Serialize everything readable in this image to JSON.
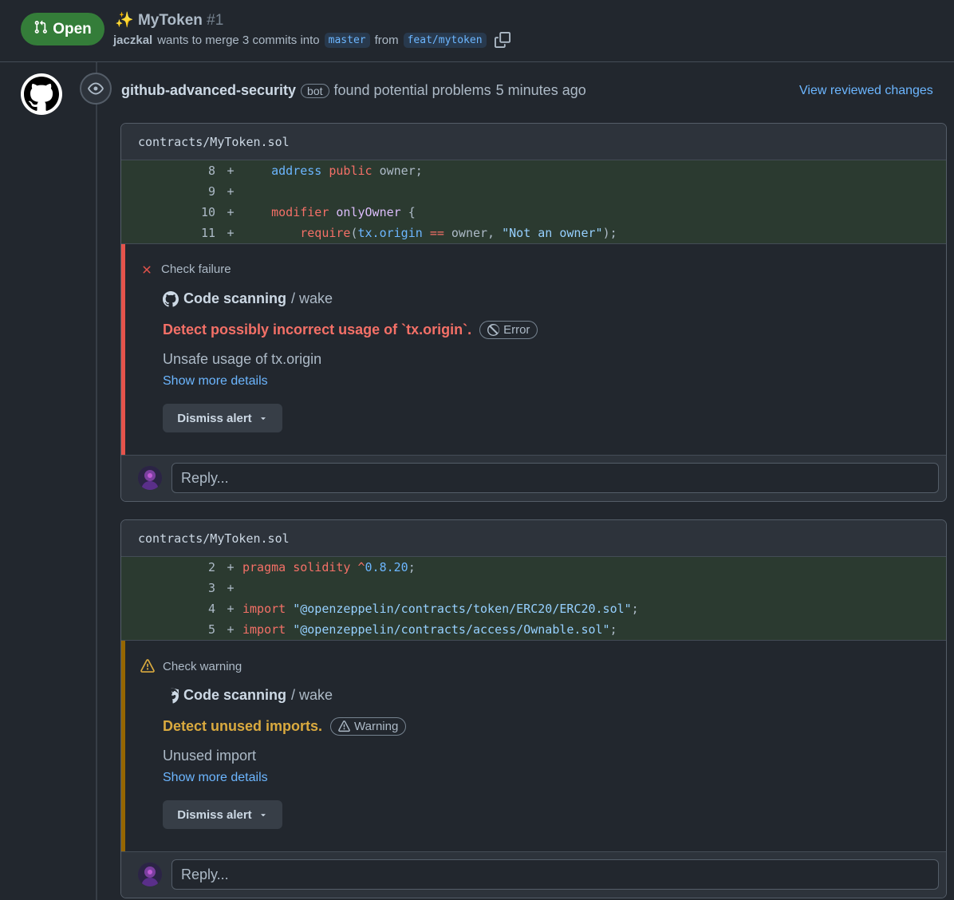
{
  "pr": {
    "status": "Open",
    "sparkle": "✨",
    "title": "MyToken",
    "number": "#1",
    "author": "jaczkal",
    "merge_text": "wants to merge 3 commits into",
    "base_branch": "master",
    "from_text": "from",
    "head_branch": "feat/mytoken"
  },
  "review": {
    "author": "github-advanced-security",
    "bot_label": "bot",
    "action": "found potential problems",
    "time": "5 minutes ago",
    "view_link": "View reviewed changes"
  },
  "threads": [
    {
      "file": "contracts/MyToken.sol",
      "lines": [
        {
          "num": "8",
          "sign": "+"
        },
        {
          "num": "9",
          "sign": "+"
        },
        {
          "num": "10",
          "sign": "+"
        },
        {
          "num": "11",
          "sign": "+"
        }
      ],
      "alert": {
        "status": "Check failure",
        "tool_name": "Code scanning",
        "tool_sep": "/ wake",
        "title": "Detect possibly incorrect usage of `tx.origin`.",
        "severity": "Error",
        "description": "Unsafe usage of tx.origin",
        "more": "Show more details",
        "dismiss": "Dismiss alert",
        "color": "#e5534b",
        "title_color": "#f47067"
      },
      "reply_placeholder": "Reply..."
    },
    {
      "file": "contracts/MyToken.sol",
      "lines": [
        {
          "num": "2",
          "sign": "+"
        },
        {
          "num": "3",
          "sign": "+"
        },
        {
          "num": "4",
          "sign": "+"
        },
        {
          "num": "5",
          "sign": "+"
        }
      ],
      "alert": {
        "status": "Check warning",
        "tool_name": "Code scanning",
        "tool_sep": "/ wake",
        "title": "Detect unused imports.",
        "severity": "Warning",
        "description": "Unused import",
        "more": "Show more details",
        "dismiss": "Dismiss alert",
        "color": "#966600",
        "title_color": "#daaa3f"
      },
      "reply_placeholder": "Reply..."
    }
  ],
  "code": {
    "t1": {
      "l8": {
        "a": "address",
        "b": "public",
        "c": "owner;"
      },
      "l10": {
        "a": "modifier",
        "b": "onlyOwner",
        "c": "{"
      },
      "l11": {
        "a": "require",
        "b": "(",
        "c": "tx.origin",
        "d": "==",
        "e": "owner,",
        "f": "\"Not an owner\"",
        "g": ");"
      }
    },
    "t2": {
      "l2": {
        "a": "pragma",
        "b": "solidity",
        "c": "^",
        "d": "0.8.20",
        "e": ";"
      },
      "l4": {
        "a": "import",
        "b": "\"@openzeppelin/contracts/token/ERC20/ERC20.sol\"",
        "c": ";"
      },
      "l5": {
        "a": "import",
        "b": "\"@openzeppelin/contracts/access/Ownable.sol\"",
        "c": ";"
      }
    }
  },
  "colors": {
    "open_green": "#347d39",
    "link_blue": "#6cb6ff",
    "diff_added_bg": "#2b3a30",
    "error_red": "#e5534b",
    "warning_yellow": "#966600"
  },
  "icons": [
    "git-pull-request-icon",
    "copy-icon",
    "github-logo-icon",
    "eye-icon",
    "x-icon",
    "alert-triangle-icon",
    "github-mark-icon",
    "circle-slash-icon",
    "chevron-down-icon"
  ]
}
